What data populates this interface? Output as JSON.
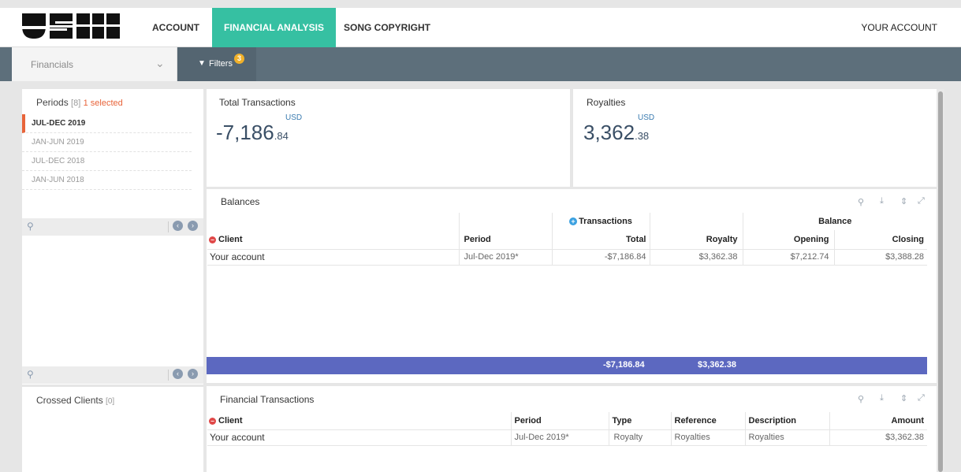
{
  "nav": {
    "account": "ACCOUNT",
    "financial_analysis": "FINANCIAL ANALYSIS",
    "song_copyright": "SONG COPYRIGHT",
    "your_account": "YOUR ACCOUNT"
  },
  "subbar": {
    "select_value": "Financials",
    "filters_label": "Filters",
    "filters_count": "3"
  },
  "periods": {
    "title": "Periods",
    "count": "[8]",
    "selected": "1 selected",
    "items": [
      "JUL-DEC 2019",
      "JAN-JUN 2019",
      "JUL-DEC 2018",
      "JAN-JUN 2018"
    ]
  },
  "crossed_clients": {
    "title": "Crossed Clients",
    "count": "[0]"
  },
  "total_transactions": {
    "title": "Total Transactions",
    "currency": "USD",
    "integer": "-7,186",
    "decimal": ".84"
  },
  "royalties": {
    "title": "Royalties",
    "currency": "USD",
    "integer": "3,362",
    "decimal": ".38"
  },
  "balances": {
    "title": "Balances",
    "group_transactions": "Transactions",
    "group_balance": "Balance",
    "columns": [
      "Client",
      "Period",
      "Total",
      "Royalty",
      "Opening",
      "Closing"
    ],
    "rows": [
      {
        "client": "Your account",
        "period": "Jul-Dec 2019*",
        "total": "-$7,186.84",
        "royalty": "$3,362.38",
        "opening": "$7,212.74",
        "closing": "$3,388.28"
      }
    ],
    "totals": {
      "total": "-$7,186.84",
      "royalty": "$3,362.38"
    }
  },
  "financial_transactions": {
    "title": "Financial Transactions",
    "columns": [
      "Client",
      "Period",
      "Type",
      "Reference",
      "Description",
      "Amount"
    ],
    "rows": [
      {
        "client": "Your account",
        "period": "Jul-Dec 2019*",
        "type": "Royalty",
        "reference": "Royalties",
        "description": "Royalties",
        "amount": "$3,362.38"
      }
    ]
  },
  "colors": {
    "accent_green": "#36c0a2",
    "accent_orange": "#e8643a",
    "total_bar": "#5c68c0",
    "subbar": "#5d6f7b"
  }
}
